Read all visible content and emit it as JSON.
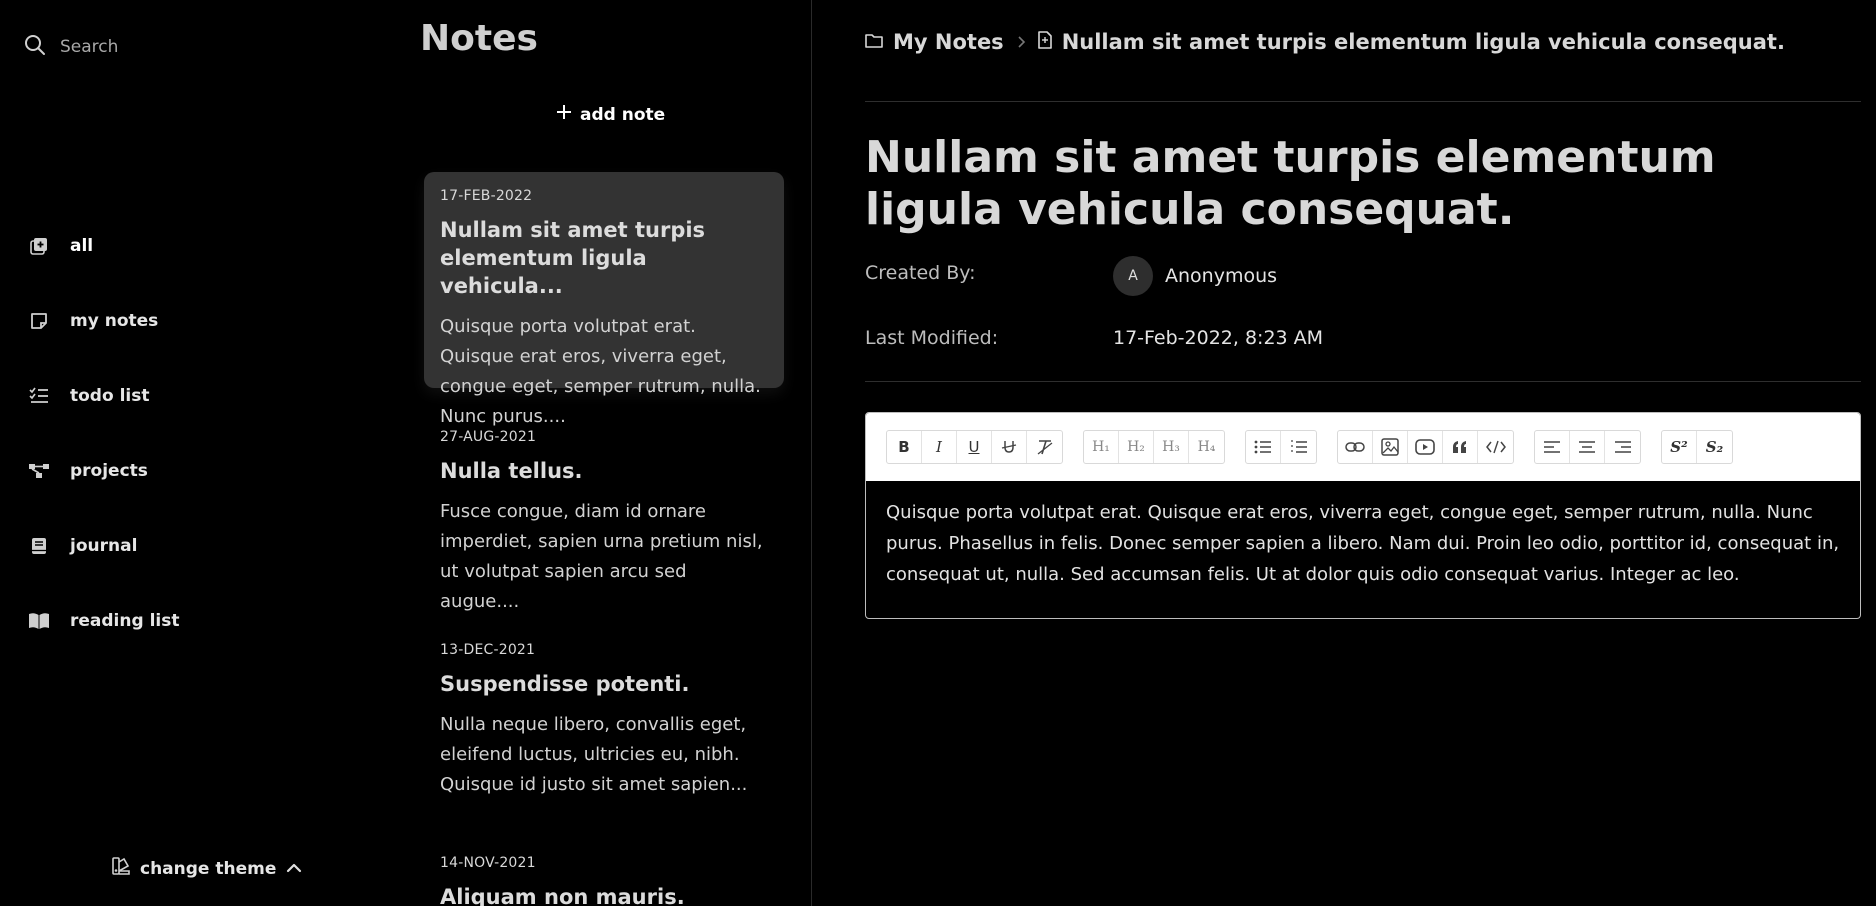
{
  "sidebar": {
    "search_placeholder": "Search",
    "items": [
      {
        "label": "all",
        "icon": "add-note-icon"
      },
      {
        "label": "my notes",
        "icon": "sticky-note-icon"
      },
      {
        "label": "todo list",
        "icon": "checklist-icon"
      },
      {
        "label": "projects",
        "icon": "project-tree-icon"
      },
      {
        "label": "journal",
        "icon": "journal-book-icon"
      },
      {
        "label": "reading list",
        "icon": "open-book-icon"
      }
    ],
    "change_theme_label": "change theme"
  },
  "notes": {
    "title": "Notes",
    "add_label": "add note",
    "list": [
      {
        "date": "17-FEB-2022",
        "title": "Nullam sit amet turpis elementum ligula vehicula...",
        "excerpt": "Quisque porta volutpat erat. Quisque erat eros, viverra eget, congue eget, semper rutrum, nulla. Nunc purus....",
        "selected": true
      },
      {
        "date": "27-AUG-2021",
        "title": "Nulla tellus.",
        "excerpt": "Fusce congue, diam id ornare imperdiet, sapien urna pretium nisl, ut volutpat sapien arcu sed augue...."
      },
      {
        "date": "13-DEC-2021",
        "title": "Suspendisse potenti.",
        "excerpt": "Nulla neque libero, convallis eget, eleifend luctus, ultricies eu, nibh. Quisque id justo sit amet sapien..."
      },
      {
        "date": "14-NOV-2021",
        "title": "Aliquam non mauris.",
        "excerpt": ""
      }
    ]
  },
  "editor": {
    "breadcrumb": {
      "folder": "My Notes",
      "note": "Nullam sit amet turpis elementum ligula vehicula consequat."
    },
    "title": "Nullam sit amet turpis elementum ligula vehicula consequat.",
    "created_by_label": "Created By:",
    "author_initial": "A",
    "author": "Anonymous",
    "modified_label": "Last Modified:",
    "modified_value": "17-Feb-2022, 8:23 AM",
    "toolbar": {
      "bold": "B",
      "italic": "I",
      "underline": "U",
      "h1": "H₁",
      "h2": "H₂",
      "h3": "H₃",
      "h4": "H₄",
      "superscript": "S²",
      "subscript": "S₂"
    },
    "body": "Quisque porta volutpat erat. Quisque erat eros, viverra eget, congue eget, semper rutrum, nulla. Nunc purus. Phasellus in felis. Donec semper sapien a libero. Nam dui. Proin leo odio, porttitor id, consequat in, consequat ut, nulla. Sed accumsan felis. Ut at dolor quis odio consequat varius. Integer ac leo."
  }
}
